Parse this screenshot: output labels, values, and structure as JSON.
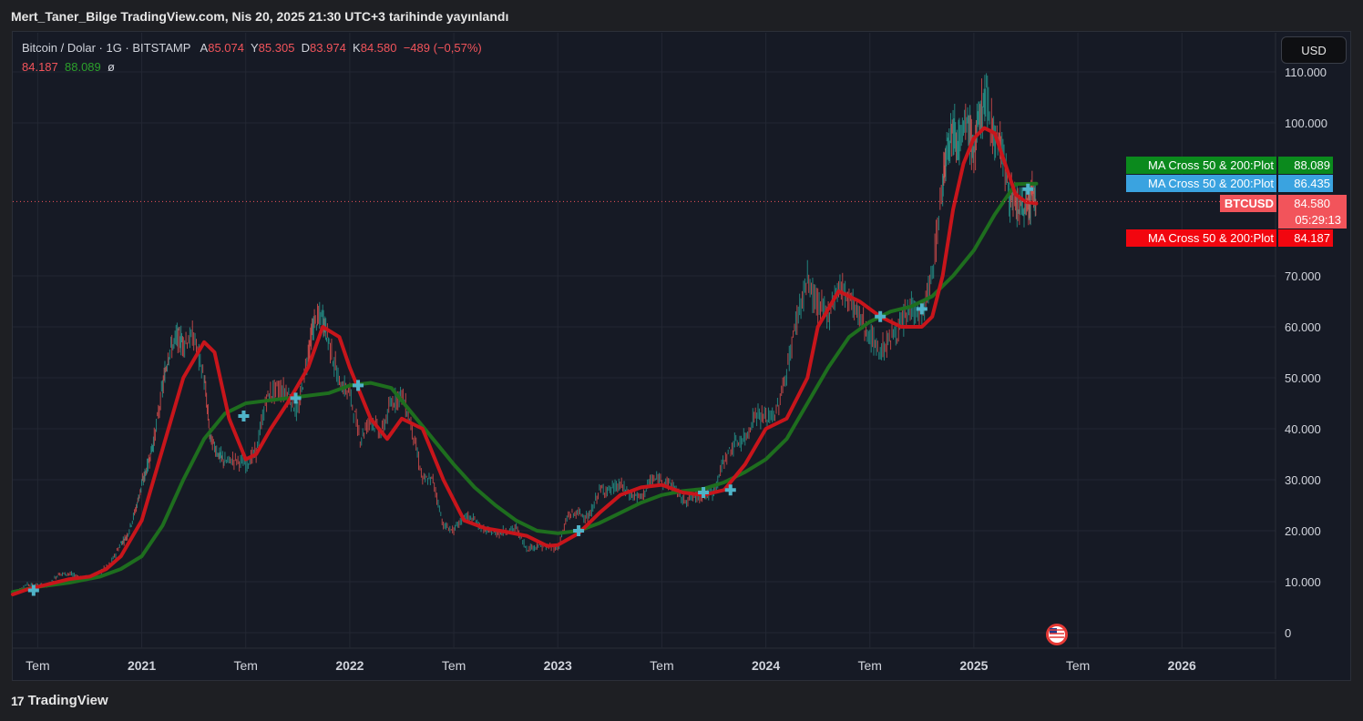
{
  "header": {
    "published": "Mert_Taner_Bilge TradingView.com, Nis 20, 2025 21:30 UTC+3 tarihinde yayınlandı"
  },
  "legend": {
    "symbol": "Bitcoin / Dolar · 1G · BITSTAMP",
    "open_label": "A",
    "open": "85.074",
    "high_label": "Y",
    "high": "85.305",
    "low_label": "D",
    "low": "83.974",
    "close_label": "K",
    "close": "84.580",
    "change": "−489 (−0,57%)",
    "ma_fast": "84.187",
    "ma_slow": "88.089",
    "ma_cross": "ø"
  },
  "currency": "USD",
  "footer": {
    "brand": "TradingView"
  },
  "colors": {
    "up": "#26a69a",
    "down": "#ef5350",
    "ma_fast": "#c8151b",
    "ma_slow": "#1e6e1e",
    "cross": "#4fb3c8",
    "grid": "#232733",
    "text": "#d1d4dc"
  },
  "chart_data": {
    "type": "line",
    "title": "Bitcoin / Dolar · 1G · BITSTAMP",
    "x_ticks": [
      "Tem",
      "2021",
      "Tem",
      "2022",
      "Tem",
      "2023",
      "Tem",
      "2024",
      "Tem",
      "2025",
      "Tem",
      "2026"
    ],
    "x_range": [
      2020.38,
      2026.45
    ],
    "y_ticks": [
      "0",
      "10.000",
      "20.000",
      "30.000",
      "40.000",
      "50.000",
      "60.000",
      "70.000",
      "100.000",
      "110.000"
    ],
    "ylim": [
      0,
      115000
    ],
    "price_series": {
      "name": "BTCUSD",
      "x": [
        2020.38,
        2020.45,
        2020.5,
        2020.55,
        2020.6,
        2020.65,
        2020.7,
        2020.75,
        2020.8,
        2020.85,
        2020.9,
        2020.93,
        2020.97,
        2021.0,
        2021.03,
        2021.06,
        2021.1,
        2021.13,
        2021.17,
        2021.2,
        2021.25,
        2021.3,
        2021.33,
        2021.37,
        2021.4,
        2021.45,
        2021.5,
        2021.55,
        2021.6,
        2021.65,
        2021.7,
        2021.75,
        2021.8,
        2021.83,
        2021.87,
        2021.9,
        2021.95,
        2022.0,
        2022.05,
        2022.1,
        2022.15,
        2022.2,
        2022.25,
        2022.3,
        2022.35,
        2022.4,
        2022.45,
        2022.5,
        2022.55,
        2022.6,
        2022.65,
        2022.7,
        2022.75,
        2022.8,
        2022.85,
        2022.9,
        2022.95,
        2023.0,
        2023.05,
        2023.1,
        2023.15,
        2023.2,
        2023.25,
        2023.3,
        2023.35,
        2023.4,
        2023.45,
        2023.5,
        2023.55,
        2023.6,
        2023.65,
        2023.7,
        2023.75,
        2023.8,
        2023.85,
        2023.9,
        2023.95,
        2024.0,
        2024.05,
        2024.1,
        2024.15,
        2024.2,
        2024.25,
        2024.3,
        2024.35,
        2024.4,
        2024.45,
        2024.5,
        2024.55,
        2024.6,
        2024.65,
        2024.7,
        2024.75,
        2024.8,
        2024.85,
        2024.87,
        2024.9,
        2024.93,
        2024.97,
        2025.0,
        2025.03,
        2025.06,
        2025.1,
        2025.13,
        2025.17,
        2025.2,
        2025.23,
        2025.26,
        2025.28,
        2025.3
      ],
      "y": [
        7500,
        9500,
        9300,
        9200,
        11500,
        11600,
        10800,
        10800,
        11900,
        13500,
        17500,
        19000,
        24000,
        29000,
        33000,
        38000,
        48000,
        55000,
        58000,
        57000,
        58000,
        50000,
        38000,
        35000,
        33500,
        34000,
        33000,
        35500,
        46000,
        48000,
        47000,
        43000,
        55000,
        61000,
        62000,
        57000,
        49000,
        47000,
        38000,
        42000,
        39000,
        45000,
        47000,
        40000,
        30000,
        30000,
        21000,
        20000,
        23000,
        22000,
        20000,
        19500,
        20000,
        20500,
        16500,
        17000,
        16800,
        16600,
        23000,
        23500,
        22500,
        28000,
        28000,
        29000,
        27000,
        26500,
        30000,
        30000,
        29000,
        26000,
        26500,
        27000,
        27500,
        34000,
        37000,
        38000,
        43000,
        42000,
        43000,
        51000,
        62000,
        69000,
        64000,
        62500,
        68000,
        66000,
        62000,
        58000,
        55000,
        58000,
        60000,
        64000,
        62000,
        70000,
        88000,
        96000,
        99000,
        96000,
        100000,
        94000,
        102000,
        105000,
        97000,
        96000,
        86000,
        84000,
        83000,
        84000,
        86000,
        84580
      ]
    },
    "ma_fast": {
      "name": "MA Cross 50 & 200:Plot",
      "last": "84.187",
      "x": [
        2020.38,
        2020.45,
        2020.55,
        2020.65,
        2020.75,
        2020.83,
        2020.9,
        2021.0,
        2021.1,
        2021.2,
        2021.3,
        2021.35,
        2021.42,
        2021.5,
        2021.55,
        2021.62,
        2021.7,
        2021.8,
        2021.87,
        2021.95,
        2022.0,
        2022.1,
        2022.18,
        2022.25,
        2022.35,
        2022.45,
        2022.55,
        2022.65,
        2022.75,
        2022.85,
        2022.95,
        2023.0,
        2023.1,
        2023.2,
        2023.3,
        2023.4,
        2023.5,
        2023.6,
        2023.7,
        2023.8,
        2023.9,
        2024.0,
        2024.1,
        2024.2,
        2024.25,
        2024.35,
        2024.45,
        2024.55,
        2024.65,
        2024.75,
        2024.8,
        2024.85,
        2024.9,
        2024.95,
        2025.0,
        2025.05,
        2025.1,
        2025.15,
        2025.2,
        2025.25,
        2025.3
      ],
      "y": [
        7500,
        8500,
        9500,
        10500,
        11000,
        12500,
        15000,
        22000,
        36000,
        50000,
        57000,
        55000,
        42000,
        34000,
        35000,
        40000,
        45000,
        52000,
        60000,
        58000,
        52000,
        42000,
        38000,
        42000,
        40000,
        30000,
        22000,
        20500,
        19800,
        19000,
        17000,
        17200,
        19500,
        23500,
        27000,
        28500,
        29000,
        27500,
        27000,
        28000,
        33000,
        40000,
        42000,
        50000,
        60000,
        67000,
        65000,
        62000,
        60000,
        60000,
        62000,
        70000,
        83000,
        92000,
        97000,
        99000,
        98000,
        92000,
        86000,
        84500,
        84187
      ]
    },
    "ma_slow": {
      "name": "MA Cross 50 & 200:Plot",
      "last": "88.089",
      "x": [
        2020.38,
        2020.5,
        2020.65,
        2020.8,
        2020.9,
        2021.0,
        2021.1,
        2021.2,
        2021.3,
        2021.4,
        2021.5,
        2021.6,
        2021.7,
        2021.8,
        2021.9,
        2022.0,
        2022.1,
        2022.2,
        2022.3,
        2022.4,
        2022.5,
        2022.6,
        2022.7,
        2022.8,
        2022.9,
        2023.0,
        2023.1,
        2023.2,
        2023.3,
        2023.4,
        2023.5,
        2023.6,
        2023.7,
        2023.8,
        2023.9,
        2024.0,
        2024.1,
        2024.2,
        2024.3,
        2024.4,
        2024.5,
        2024.6,
        2024.7,
        2024.8,
        2024.9,
        2025.0,
        2025.1,
        2025.2,
        2025.3
      ],
      "y": [
        8000,
        9000,
        9800,
        11000,
        12500,
        15000,
        21000,
        30000,
        38000,
        43000,
        45000,
        45500,
        46000,
        46500,
        47000,
        48500,
        49000,
        48000,
        43000,
        38000,
        33000,
        28500,
        25000,
        22000,
        20000,
        19500,
        20000,
        21500,
        23500,
        25500,
        27000,
        27800,
        28200,
        29500,
        31500,
        34000,
        38000,
        45000,
        52000,
        58000,
        61000,
        63000,
        64000,
        66000,
        70000,
        75000,
        82000,
        88000,
        88089
      ]
    },
    "ma_blue": {
      "name": "MA Cross 50 & 200:Plot",
      "last": "86.435"
    },
    "crosses": {
      "x": [
        2020.48,
        2021.49,
        2021.74,
        2022.04,
        2023.1,
        2023.7,
        2023.83,
        2024.55,
        2024.75,
        2025.26
      ],
      "y": [
        8300,
        42500,
        46000,
        48500,
        20000,
        27500,
        28000,
        62000,
        63500,
        87000
      ]
    },
    "price_labels": [
      {
        "name": "MA Cross 50 & 200:Plot",
        "value": "88.089",
        "color": "#0b8a1d"
      },
      {
        "name": "MA Cross 50 & 200:Plot",
        "value": "86.435",
        "color": "#3aa3e0"
      },
      {
        "name": "BTCUSD",
        "value": "84.580",
        "sub": "05:29:13",
        "color": "#f2545b"
      },
      {
        "name": "MA Cross 50 & 200:Plot",
        "value": "84.187",
        "color": "#f2060f"
      }
    ],
    "grid": true
  }
}
